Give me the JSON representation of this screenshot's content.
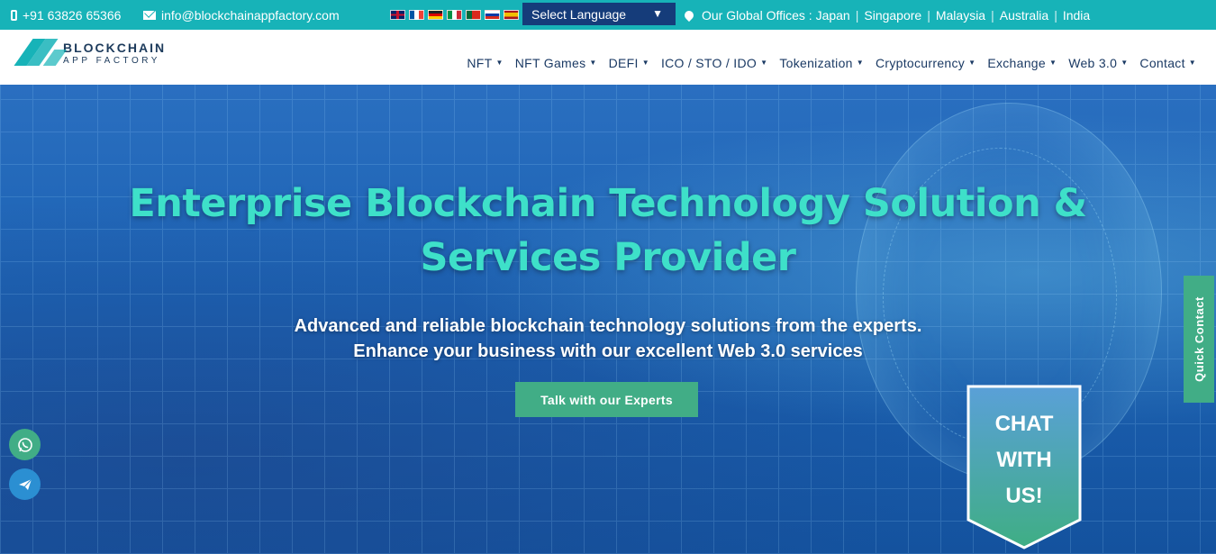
{
  "topbar": {
    "phone": "+91 63826 65366",
    "email": "info@blockchainappfactory.com",
    "language_select": "Select Language",
    "offices_label": "Our Global Offices :",
    "offices": [
      "Japan",
      "Singapore",
      "Malaysia",
      "Australia",
      "India"
    ],
    "flags": [
      "uk-flag-icon",
      "fr-flag-icon",
      "de-flag-icon",
      "it-flag-icon",
      "pt-flag-icon",
      "ru-flag-icon",
      "es-flag-icon"
    ]
  },
  "logo": {
    "line1": "BLOCKCHAIN",
    "line2": "APP FACTORY"
  },
  "nav": {
    "items": [
      {
        "label": "NFT",
        "has_dropdown": true
      },
      {
        "label": "NFT Games",
        "has_dropdown": true
      },
      {
        "label": "DEFI",
        "has_dropdown": true
      },
      {
        "label": "ICO / STO / IDO",
        "has_dropdown": true
      },
      {
        "label": "Tokenization",
        "has_dropdown": true
      },
      {
        "label": "Cryptocurrency",
        "has_dropdown": true
      },
      {
        "label": "Exchange",
        "has_dropdown": true
      },
      {
        "label": "Web 3.0",
        "has_dropdown": true
      },
      {
        "label": "Contact",
        "has_dropdown": true
      }
    ]
  },
  "hero": {
    "title_line1": "Enterprise Blockchain Technology Solution &",
    "title_line2": "Services Provider",
    "subtitle_line1": "Advanced and reliable blockchain technology solutions from the experts.",
    "subtitle_line2": "Enhance your business with our excellent Web 3.0 services",
    "cta_label": "Talk with our Experts"
  },
  "widgets": {
    "quick_contact": "Quick Contact",
    "chat_line1": "CHAT",
    "chat_line2": "WITH",
    "chat_line3": "US!"
  },
  "colors": {
    "topbar": "#17b3b8",
    "accent_green": "#41ad86",
    "headline": "#3ee0c9",
    "nav_text": "#1b3a64",
    "language_select_bg": "#153c7a"
  }
}
